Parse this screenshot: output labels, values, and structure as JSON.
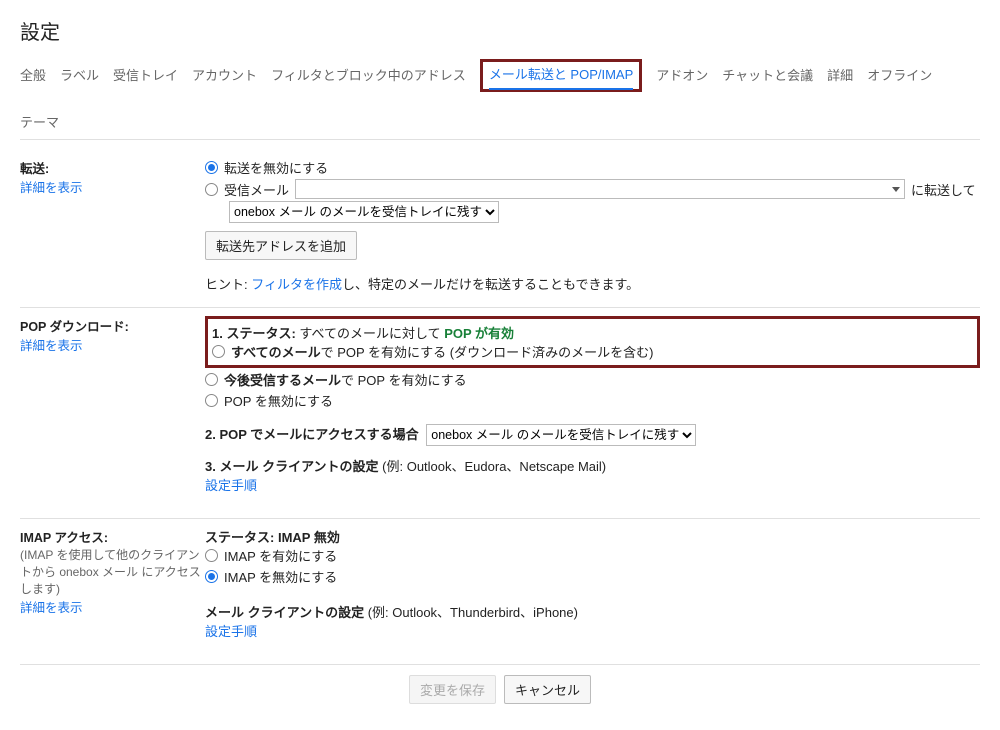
{
  "page_title": "設定",
  "tabs": {
    "general": "全般",
    "labels": "ラベル",
    "inbox": "受信トレイ",
    "accounts": "アカウント",
    "filters": "フィルタとブロック中のアドレス",
    "forwarding": "メール転送と POP/IMAP",
    "addons": "アドオン",
    "chat": "チャットと会議",
    "advanced": "詳細",
    "offline": "オフライン",
    "themes": "テーマ"
  },
  "forwarding": {
    "section_title": "転送:",
    "learn_more": "詳細を表示",
    "disable_label": "転送を無効にする",
    "incoming_prefix": "受信メール",
    "incoming_suffix": "に転送して",
    "keep_copy_select": "onebox メール のメールを受信トレイに残す",
    "add_address_btn": "転送先アドレスを追加",
    "hint_prefix": "ヒント: ",
    "hint_link": "フィルタを作成",
    "hint_suffix": "し、特定のメールだけを転送することもできます。"
  },
  "pop": {
    "section_title": "POP ダウンロード:",
    "learn_more": "詳細を表示",
    "status_label": "1. ステータス:",
    "status_text": " すべてのメールに対して ",
    "status_enabled": "POP が有効",
    "opt_all_bold": "すべてのメール",
    "opt_all_rest": "で POP を有効にする (ダウンロード済みのメールを含む)",
    "opt_future_bold": "今後受信するメール",
    "opt_future_rest": "で POP を有効にする",
    "opt_disable": "POP を無効にする",
    "access_label": "2. POP でメールにアクセスする場合",
    "access_select": "onebox メール のメールを受信トレイに残す",
    "client_label": "3. メール クライアントの設定",
    "client_example": " (例: Outlook、Eudora、Netscape Mail)",
    "client_link": "設定手順"
  },
  "imap": {
    "section_title": "IMAP アクセス:",
    "section_sub": "(IMAP を使用して他のクライアントから onebox メール にアクセスします)",
    "learn_more": "詳細を表示",
    "status_label": "ステータス: ",
    "status_value": "IMAP 無効",
    "opt_enable": "IMAP を有効にする",
    "opt_disable": "IMAP を無効にする",
    "client_label": "メール クライアントの設定",
    "client_example": " (例: Outlook、Thunderbird、iPhone)",
    "client_link": "設定手順"
  },
  "footer": {
    "save": "変更を保存",
    "cancel": "キャンセル"
  }
}
